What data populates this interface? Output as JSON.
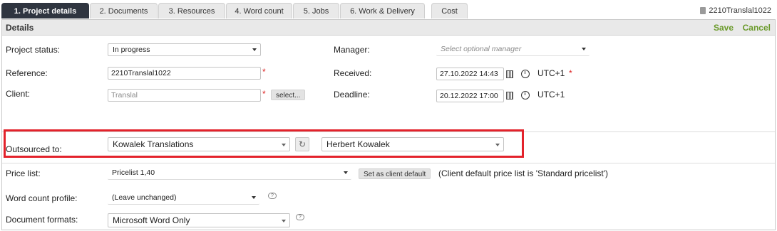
{
  "tabs": [
    {
      "label": "1. Project details",
      "active": true
    },
    {
      "label": "2. Documents"
    },
    {
      "label": "3. Resources"
    },
    {
      "label": "4. Word count"
    },
    {
      "label": "5. Jobs"
    },
    {
      "label": "6. Work & Delivery"
    },
    {
      "label": "Cost"
    }
  ],
  "project_id": "2210Translal1022",
  "header": {
    "title": "Details",
    "save": "Save",
    "cancel": "Cancel"
  },
  "fields": {
    "project_status": {
      "label": "Project status:",
      "value": "In progress"
    },
    "reference": {
      "label": "Reference:",
      "value": "2210Translal1022"
    },
    "client": {
      "label": "Client:",
      "placeholder": "Translal",
      "select_button": "select..."
    },
    "manager": {
      "label": "Manager:",
      "placeholder": "Select optional manager"
    },
    "received": {
      "label": "Received:",
      "value": "27.10.2022 14:43",
      "timezone": "UTC+1"
    },
    "deadline": {
      "label": "Deadline:",
      "value": "20.12.2022 17:00",
      "timezone": "UTC+1"
    },
    "outsourced_to": {
      "label": "Outsourced to:",
      "company": "Kowalek Translations",
      "person": "Herbert Kowalek"
    },
    "price_list": {
      "label": "Price list:",
      "value": "Pricelist 1,40",
      "set_default": "Set as client default",
      "note": "(Client default price list is 'Standard pricelist')"
    },
    "word_count_profile": {
      "label": "Word count profile:",
      "value": "(Leave unchanged)"
    },
    "document_formats": {
      "label": "Document formats:",
      "value": "Microsoft Word Only"
    }
  },
  "required_mark": "*",
  "colors": {
    "active_tab": "#2f3540",
    "action": "#6a9a2a",
    "highlight": "#e3222b",
    "required": "#dd2222"
  }
}
